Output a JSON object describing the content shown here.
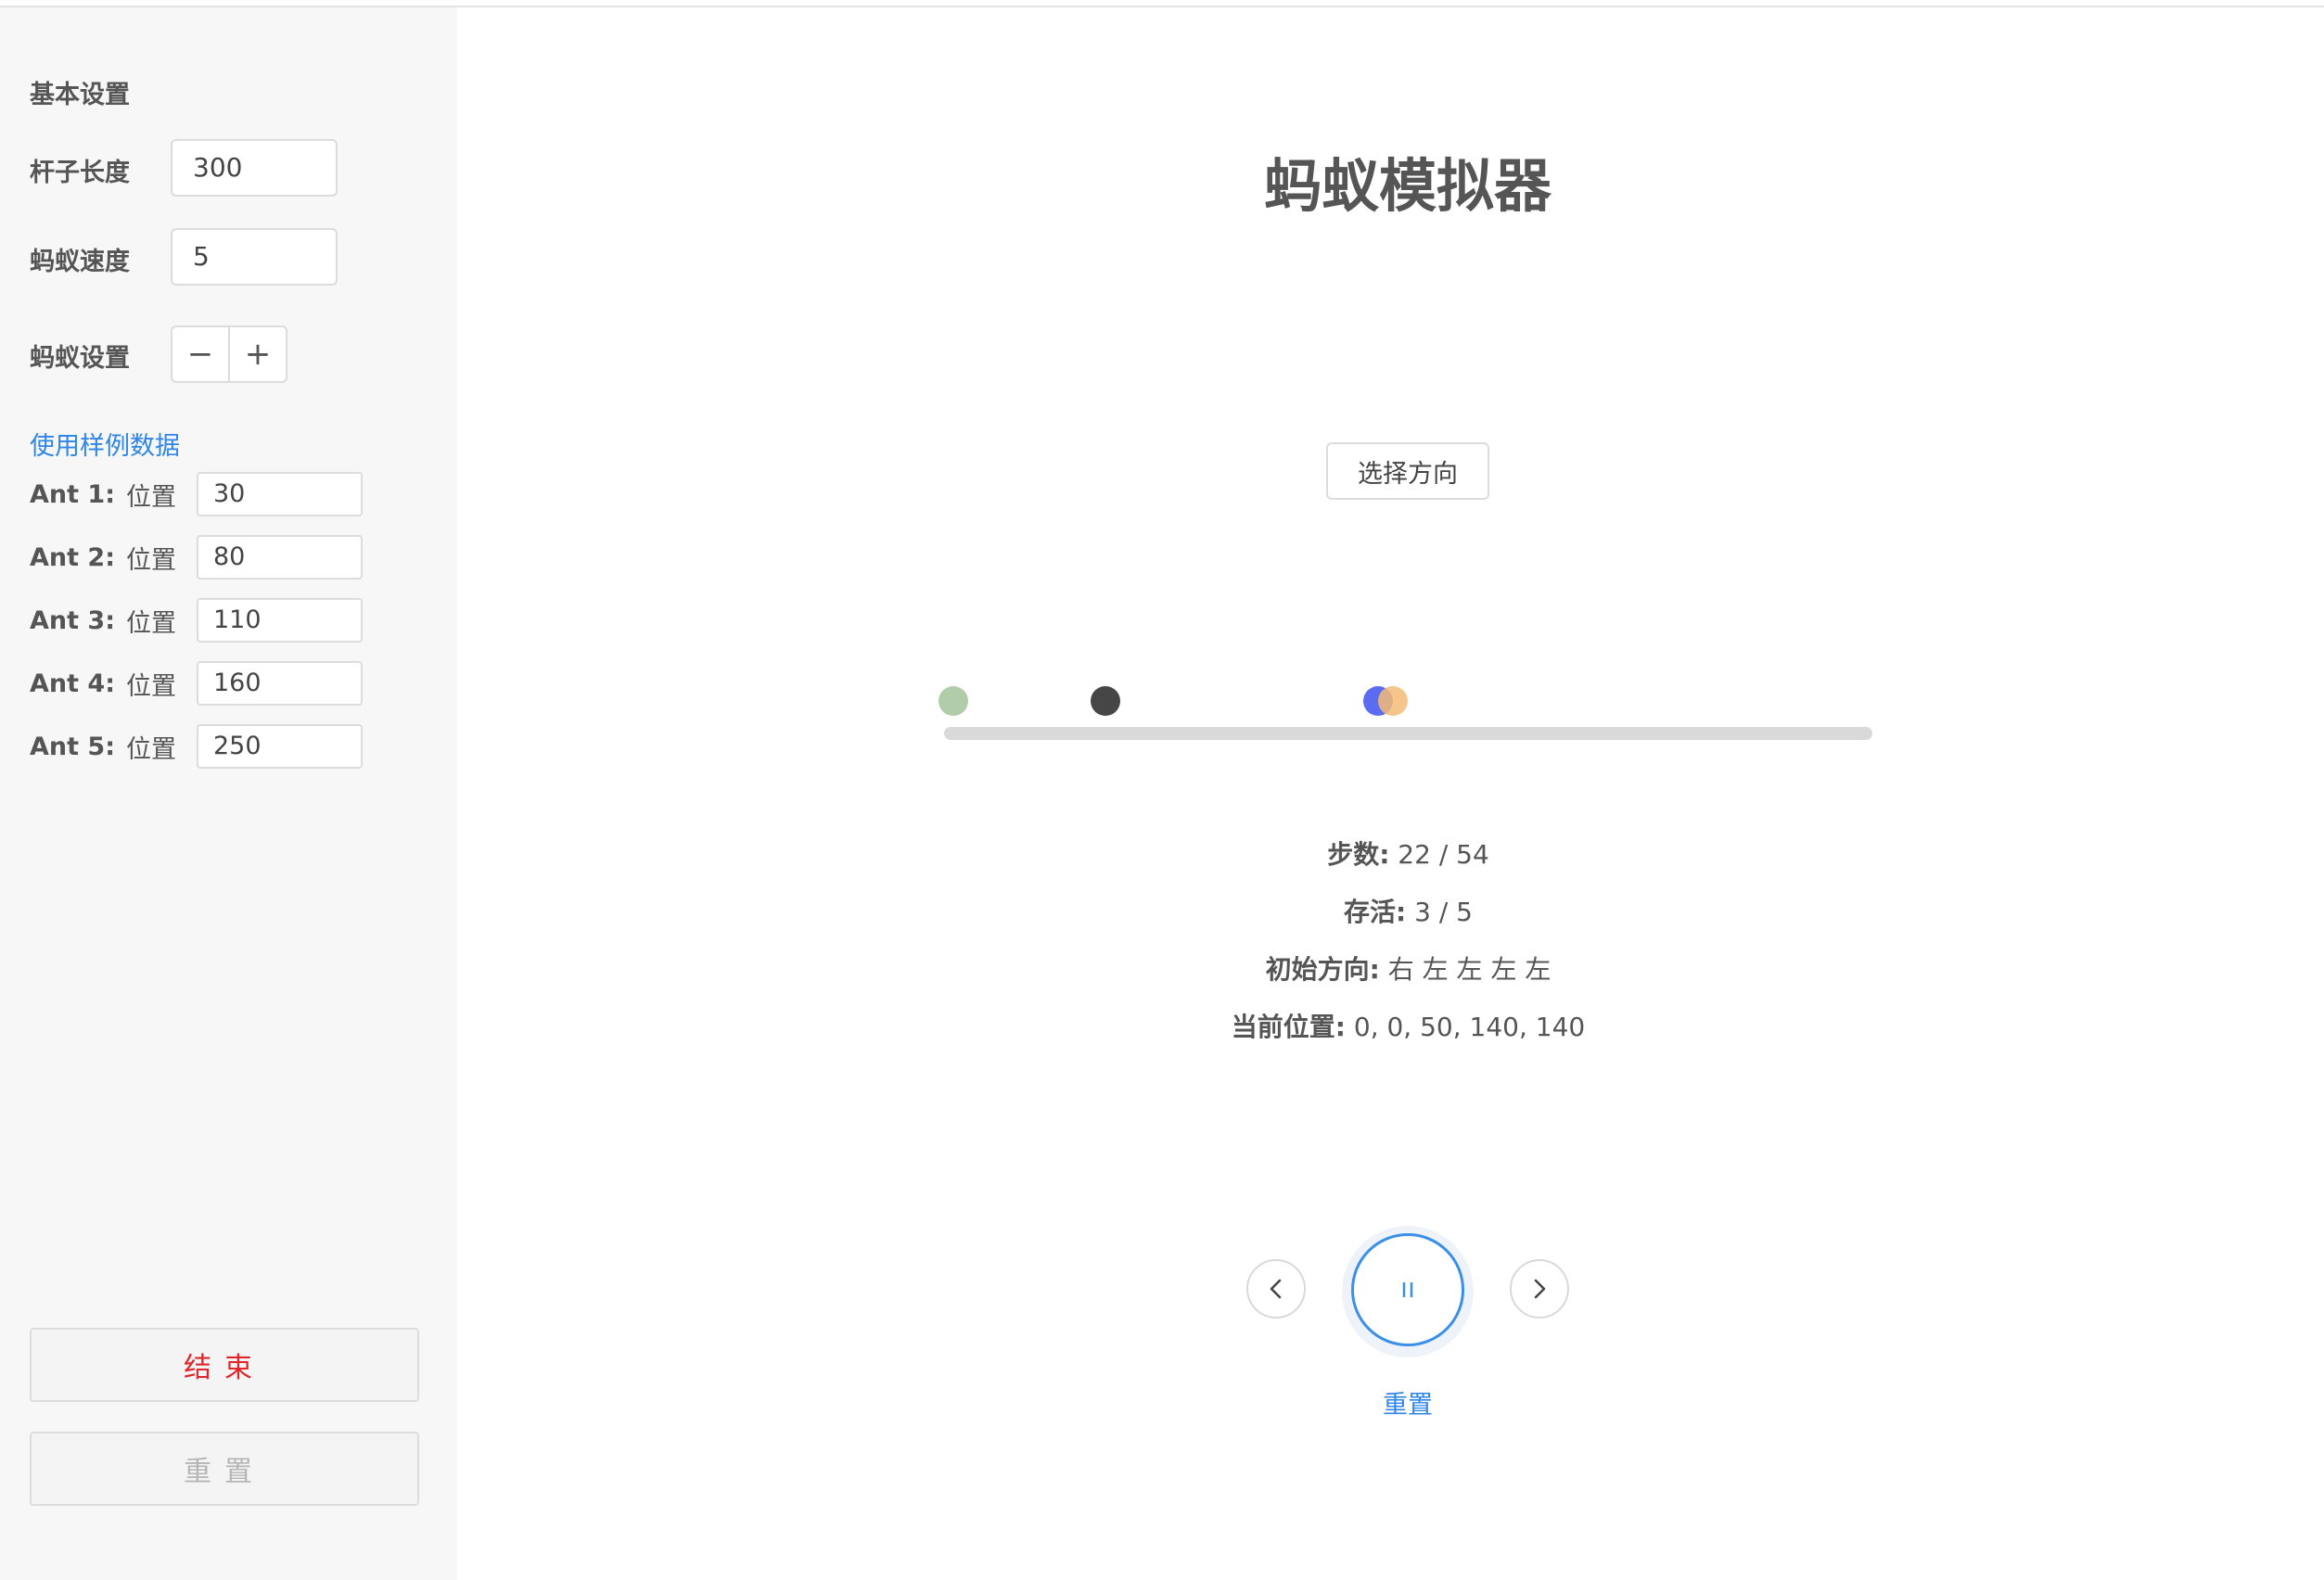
{
  "sidebar": {
    "section_title": "基本设置",
    "rod_length_label": "杆子长度",
    "rod_length_value": "300",
    "ant_speed_label": "蚂蚁速度",
    "ant_speed_value": "5",
    "ant_settings_label": "蚂蚁设置",
    "minus_label": "−",
    "plus_label": "+",
    "sample_link": "使用样例数据",
    "position_label": "位置",
    "ants": [
      {
        "name": "Ant 1:",
        "position": "30"
      },
      {
        "name": "Ant 2:",
        "position": "80"
      },
      {
        "name": "Ant 3:",
        "position": "110"
      },
      {
        "name": "Ant 4:",
        "position": "160"
      },
      {
        "name": "Ant 5:",
        "position": "250"
      }
    ],
    "end_button": "结束",
    "reset_button": "重置"
  },
  "main": {
    "title": "蚂蚁模拟器",
    "choose_direction_button": "选择方向",
    "rod_length": 300,
    "ants_on_rod": [
      {
        "position": 0,
        "color": "#b0cca8"
      },
      {
        "position": 50,
        "color": "#464646"
      },
      {
        "position": 140,
        "color": "#5b6cf0"
      },
      {
        "position": 145,
        "color": "#f5bb74"
      }
    ],
    "stats": {
      "steps_label": "步数:",
      "steps_value": "22 / 54",
      "alive_label": "存活:",
      "alive_value": "3 / 5",
      "init_dir_label": "初始方向:",
      "init_dir_value": "右 左 左 左 左",
      "current_pos_label": "当前位置:",
      "current_pos_value": "0, 0, 50, 140, 140"
    },
    "controls": {
      "prev_icon": "chevron-left-icon",
      "play_icon": "pause-icon",
      "next_icon": "chevron-right-icon",
      "reset_link": "重置"
    },
    "accent_color": "#3a8fe8",
    "danger_color": "#e0262b"
  }
}
